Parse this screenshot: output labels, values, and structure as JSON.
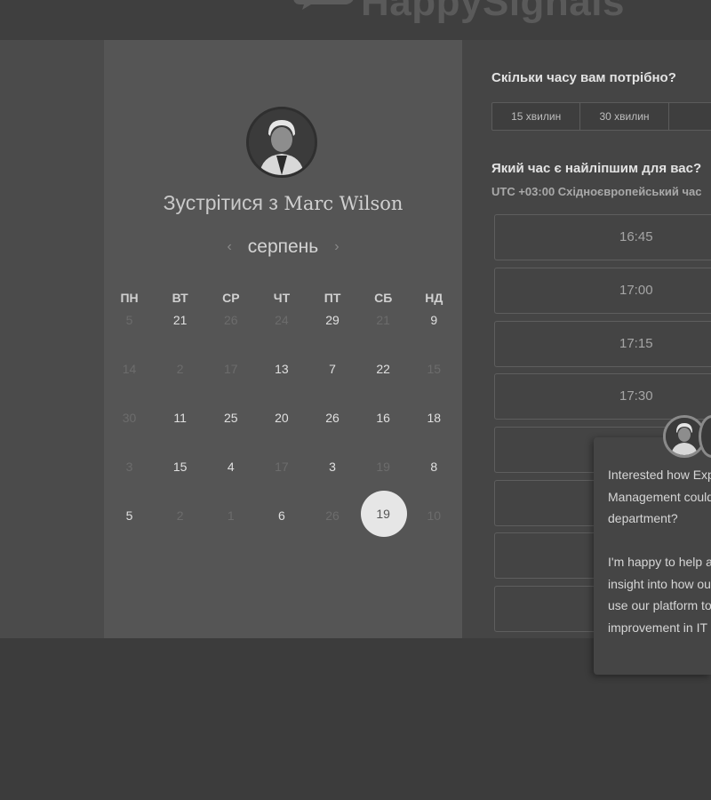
{
  "header": {
    "brand_name": "HappySignals"
  },
  "host": {
    "meet_prefix": "Зустрітися з",
    "name": "Marc Wilson"
  },
  "calendar": {
    "month": "серпень",
    "weekdays": [
      "ПН",
      "ВТ",
      "СР",
      "ЧТ",
      "ПТ",
      "СБ",
      "НД"
    ],
    "weeks": [
      [
        {
          "d": "5",
          "dim": true
        },
        {
          "d": "21",
          "dim": false
        },
        {
          "d": "26",
          "dim": true
        },
        {
          "d": "24",
          "dim": true
        },
        {
          "d": "29",
          "dim": false
        },
        {
          "d": "21",
          "dim": true
        },
        {
          "d": "9",
          "dim": false
        }
      ],
      [
        {
          "d": "14",
          "dim": true
        },
        {
          "d": "2",
          "dim": true
        },
        {
          "d": "17",
          "dim": true
        },
        {
          "d": "13",
          "dim": false
        },
        {
          "d": "7",
          "dim": false
        },
        {
          "d": "22",
          "dim": false
        },
        {
          "d": "15",
          "dim": true
        }
      ],
      [
        {
          "d": "30",
          "dim": true
        },
        {
          "d": "11",
          "dim": false
        },
        {
          "d": "25",
          "dim": false
        },
        {
          "d": "20",
          "dim": false
        },
        {
          "d": "26",
          "dim": false
        },
        {
          "d": "16",
          "dim": false
        },
        {
          "d": "18",
          "dim": false
        }
      ],
      [
        {
          "d": "3",
          "dim": true
        },
        {
          "d": "15",
          "dim": false
        },
        {
          "d": "4",
          "dim": false
        },
        {
          "d": "17",
          "dim": true
        },
        {
          "d": "3",
          "dim": false
        },
        {
          "d": "19",
          "dim": true
        },
        {
          "d": "8",
          "dim": false
        }
      ],
      [
        {
          "d": "5",
          "dim": false
        },
        {
          "d": "2",
          "dim": true
        },
        {
          "d": "1",
          "dim": true
        },
        {
          "d": "6",
          "dim": false
        },
        {
          "d": "26",
          "dim": true
        },
        {
          "d": "19",
          "dim": false,
          "selected": true
        },
        {
          "d": "10",
          "dim": true
        }
      ]
    ]
  },
  "booking": {
    "duration_question": "Скільки часу вам потрібно?",
    "durations": [
      "15 хвилин",
      "30 хвилин",
      ""
    ],
    "time_question": "Який час є найліпшим для вас?",
    "timezone": "UTC +03:00 Східноєвропейський час",
    "slots": [
      "16:45",
      "17:00",
      "17:15",
      "17:30",
      "",
      "",
      "",
      ""
    ]
  },
  "chat": {
    "message": "Interested how Experience Management could help your department?\n\nI'm happy to help and give insight into how our customers use our platform to drive improvement in IT productivity."
  }
}
